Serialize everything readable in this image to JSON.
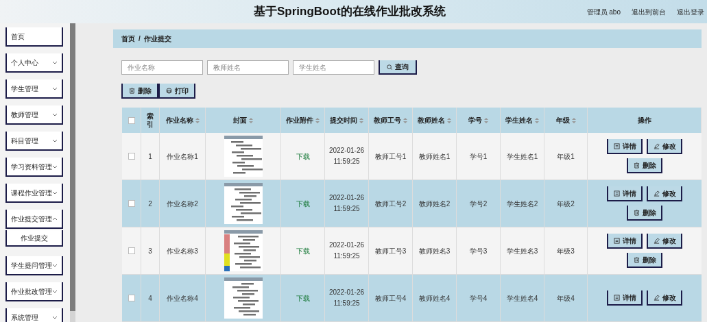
{
  "header": {
    "title": "基于SpringBoot的在线作业批改系统",
    "links": [
      "管理员 abo",
      "退出到前台",
      "退出登录"
    ]
  },
  "sidebar": {
    "items": [
      {
        "label": "首页",
        "kind": "link"
      },
      {
        "label": "个人中心",
        "kind": "menu",
        "expanded": false
      },
      {
        "label": "学生管理",
        "kind": "menu",
        "expanded": false
      },
      {
        "label": "教师管理",
        "kind": "menu",
        "expanded": false
      },
      {
        "label": "科目管理",
        "kind": "menu",
        "expanded": false
      },
      {
        "label": "学习资料管理",
        "kind": "menu",
        "expanded": false
      },
      {
        "label": "课程作业管理",
        "kind": "menu",
        "expanded": false
      },
      {
        "label": "作业提交管理",
        "kind": "menu",
        "expanded": true,
        "children": [
          {
            "label": "作业提交"
          }
        ]
      },
      {
        "label": "学生提问管理",
        "kind": "menu",
        "expanded": false
      },
      {
        "label": "作业批改管理",
        "kind": "menu",
        "expanded": false
      },
      {
        "label": "系统管理",
        "kind": "menu",
        "expanded": false
      }
    ]
  },
  "breadcrumb": [
    "首页",
    "/",
    "作业提交"
  ],
  "search": {
    "fields": [
      {
        "placeholder": "作业名称"
      },
      {
        "placeholder": "教师姓名"
      },
      {
        "placeholder": "学生姓名"
      }
    ],
    "button": "查询"
  },
  "toolbar": [
    {
      "label": "删除",
      "kind": "delete"
    },
    {
      "label": "打印",
      "kind": "print"
    }
  ],
  "table": {
    "select_all": {
      "checked": false
    },
    "columns": [
      {
        "label": "索引",
        "sortable": false
      },
      {
        "label": "作业名称",
        "sortable": true
      },
      {
        "label": "封面",
        "sortable": true
      },
      {
        "label": "作业附件",
        "sortable": true
      },
      {
        "label": "提交时间",
        "sortable": true
      },
      {
        "label": "教师工号",
        "sortable": true
      },
      {
        "label": "教师姓名",
        "sortable": true
      },
      {
        "label": "学号",
        "sortable": true
      },
      {
        "label": "学生姓名",
        "sortable": true
      },
      {
        "label": "年级",
        "sortable": true
      },
      {
        "label": "操作",
        "sortable": false
      }
    ],
    "rows": [
      {
        "checked": false,
        "index": "1",
        "name": "作业名称1",
        "cover": {
          "kind": "picture"
        },
        "attachment": "下载",
        "time": "2022-01-26 11:59:25",
        "teacher_no": "教师工号1",
        "teacher_name": "教师姓名1",
        "student_no": "学号1",
        "student_name": "学生姓名1",
        "grade": "年级1",
        "actions": [
          {
            "label": "详情",
            "kind": "detail"
          },
          {
            "label": "修改",
            "kind": "edit"
          },
          {
            "label": "删除",
            "kind": "delete"
          }
        ]
      },
      {
        "checked": false,
        "index": "2",
        "name": "作业名称2",
        "cover": {
          "kind": "picture"
        },
        "attachment": "下载",
        "time": "2022-01-26 11:59:25",
        "teacher_no": "教师工号2",
        "teacher_name": "教师姓名2",
        "student_no": "学号2",
        "student_name": "学生姓名2",
        "grade": "年级2",
        "actions": [
          {
            "label": "详情",
            "kind": "detail"
          },
          {
            "label": "修改",
            "kind": "edit"
          },
          {
            "label": "删除",
            "kind": "delete"
          }
        ]
      },
      {
        "checked": false,
        "index": "3",
        "name": "作业名称3",
        "cover": {
          "kind": "picture"
        },
        "attachment": "下载",
        "time": "2022-01-26 11:59:25",
        "teacher_no": "教师工号3",
        "teacher_name": "教师姓名3",
        "student_no": "学号3",
        "student_name": "学生姓名3",
        "grade": "年级3",
        "actions": [
          {
            "label": "详情",
            "kind": "detail"
          },
          {
            "label": "修改",
            "kind": "edit"
          },
          {
            "label": "删除",
            "kind": "delete"
          }
        ]
      },
      {
        "checked": false,
        "index": "4",
        "name": "作业名称4",
        "cover": {
          "kind": "picture"
        },
        "attachment": "下载",
        "time": "2022-01-26 11:59:25",
        "teacher_no": "教师工号4",
        "teacher_name": "教师姓名4",
        "student_no": "学号4",
        "student_name": "学生姓名4",
        "grade": "年级4",
        "actions": [
          {
            "label": "详情",
            "kind": "detail"
          },
          {
            "label": "修改",
            "kind": "edit"
          }
        ]
      }
    ]
  }
}
